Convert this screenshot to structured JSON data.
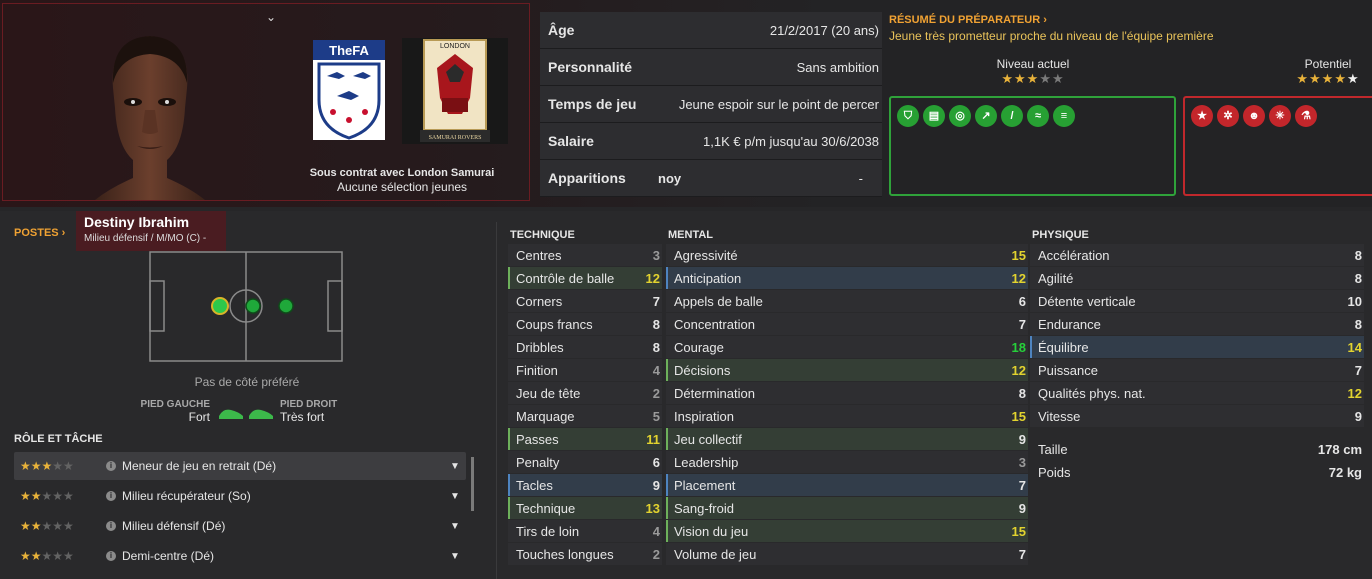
{
  "header": {
    "chevron": "⌄"
  },
  "player": {
    "name": "Destiny Ibrahim",
    "positions": "Milieu défensif / M/MO (C) -",
    "contract_line": "Sous contrat avec London Samurai",
    "youth_caps": "Aucune sélection jeunes"
  },
  "crests": {
    "fa": "TheFA",
    "club_top": "LONDON",
    "club_bottom": "SAMURAI ROVERS"
  },
  "info": [
    {
      "k": "Âge",
      "v": "21/2/2017 (20 ans)"
    },
    {
      "k": "Personnalité",
      "v": "Sans ambition"
    },
    {
      "k": "Temps de jeu",
      "v": "Jeune espoir sur le point de percer"
    },
    {
      "k": "Salaire",
      "v": "1,1K € p/m jusqu'au 30/6/2038"
    },
    {
      "k": "Apparitions",
      "v": "noy",
      "v2": "-"
    }
  ],
  "coach": {
    "title": "RÉSUMÉ DU PRÉPARATEUR ›",
    "text": "Jeune très prometteur proche du niveau de l'équipe première",
    "current_label": "Niveau actuel",
    "potential_label": "Potentiel",
    "current_stars": 3,
    "potential_stars": 4.5
  },
  "traits_good": [
    "shield",
    "notes",
    "target",
    "trend",
    "bone",
    "wings",
    "list"
  ],
  "traits_bad": [
    "star",
    "gears",
    "head",
    "burst",
    "flask"
  ],
  "postes": "POSTES ›",
  "foot": {
    "pref": "Pas de côté préféré",
    "left_label": "PIED GAUCHE",
    "left_val": "Fort",
    "right_label": "PIED DROIT",
    "right_val": "Très fort"
  },
  "roles_header": "RÔLE ET TÂCHE",
  "roles": [
    {
      "name": "Meneur de jeu en retrait (Dé)",
      "stars": 3
    },
    {
      "name": "Milieu récupérateur (So)",
      "stars": 2
    },
    {
      "name": "Milieu défensif (Dé)",
      "stars": 2
    },
    {
      "name": "Demi-centre (Dé)",
      "stars": 2
    }
  ],
  "technique": {
    "title": "TECHNIQUE",
    "items": [
      {
        "n": "Centres",
        "v": "3"
      },
      {
        "n": "Contrôle de balle",
        "v": "12"
      },
      {
        "n": "Corners",
        "v": "7"
      },
      {
        "n": "Coups francs",
        "v": "8"
      },
      {
        "n": "Dribbles",
        "v": "8"
      },
      {
        "n": "Finition",
        "v": "4"
      },
      {
        "n": "Jeu de tête",
        "v": "2"
      },
      {
        "n": "Marquage",
        "v": "5"
      },
      {
        "n": "Passes",
        "v": "11"
      },
      {
        "n": "Penalty",
        "v": "6"
      },
      {
        "n": "Tacles",
        "v": "9"
      },
      {
        "n": "Technique",
        "v": "13"
      },
      {
        "n": "Tirs de loin",
        "v": "4"
      },
      {
        "n": "Touches longues",
        "v": "2"
      }
    ]
  },
  "mental": {
    "title": "MENTAL",
    "items": [
      {
        "n": "Agressivité",
        "v": "15"
      },
      {
        "n": "Anticipation",
        "v": "12"
      },
      {
        "n": "Appels de balle",
        "v": "6"
      },
      {
        "n": "Concentration",
        "v": "7"
      },
      {
        "n": "Courage",
        "v": "18"
      },
      {
        "n": "Décisions",
        "v": "12"
      },
      {
        "n": "Détermination",
        "v": "8"
      },
      {
        "n": "Inspiration",
        "v": "15"
      },
      {
        "n": "Jeu collectif",
        "v": "9"
      },
      {
        "n": "Leadership",
        "v": "3"
      },
      {
        "n": "Placement",
        "v": "7"
      },
      {
        "n": "Sang-froid",
        "v": "9"
      },
      {
        "n": "Vision du jeu",
        "v": "15"
      },
      {
        "n": "Volume de jeu",
        "v": "7"
      }
    ]
  },
  "physique": {
    "title": "PHYSIQUE",
    "items": [
      {
        "n": "Accélération",
        "v": "8"
      },
      {
        "n": "Agilité",
        "v": "8"
      },
      {
        "n": "Détente verticale",
        "v": "10"
      },
      {
        "n": "Endurance",
        "v": "8"
      },
      {
        "n": "Équilibre",
        "v": "14"
      },
      {
        "n": "Puissance",
        "v": "7"
      },
      {
        "n": "Qualités phys. nat.",
        "v": "12"
      },
      {
        "n": "Vitesse",
        "v": "9"
      }
    ]
  },
  "body": [
    {
      "n": "Taille",
      "v": "178 cm"
    },
    {
      "n": "Poids",
      "v": "72 kg"
    }
  ],
  "colors": {
    "accent": "#f0a233",
    "good": "#27a033",
    "bad": "#c3262b",
    "highlight": "#e2d32f"
  }
}
